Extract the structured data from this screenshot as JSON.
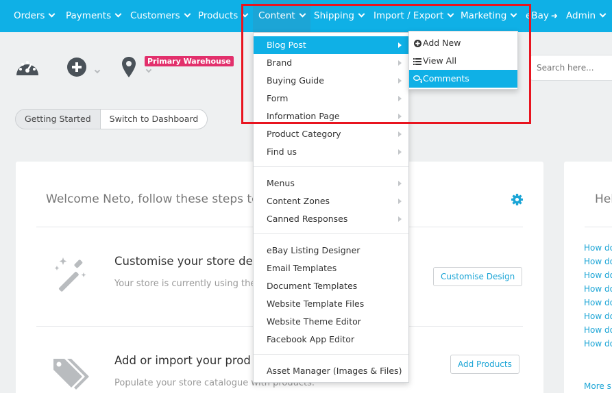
{
  "nav": {
    "items": [
      {
        "label": "Orders"
      },
      {
        "label": "Payments"
      },
      {
        "label": "Customers"
      },
      {
        "label": "Products"
      },
      {
        "label": "Content"
      },
      {
        "label": "Shipping"
      },
      {
        "label": "Import / Export"
      },
      {
        "label": "Marketing"
      },
      {
        "label": "eBay"
      },
      {
        "label": "Admin"
      }
    ]
  },
  "toolbar": {
    "warehouse_badge": "Primary Warehouse",
    "search_placeholder": "Search here..."
  },
  "view_toggle": {
    "getting_started": "Getting Started",
    "switch_dashboard": "Switch to Dashboard"
  },
  "welcome": {
    "title": "Welcome Neto, follow these steps to",
    "steps": [
      {
        "title": "Customise your store de",
        "subtitle": "Your store is currently using the",
        "button": "Customise Design"
      },
      {
        "title": "Add or import your prod",
        "subtitle": "Populate your store catalogue with products.",
        "button": "Add Products"
      }
    ]
  },
  "help": {
    "title": "Hel",
    "links": [
      "How do",
      "How do",
      "How do",
      "How do",
      "How do",
      "How do",
      "How do",
      "How do"
    ],
    "more": "More s"
  },
  "content_menu": {
    "groups": [
      [
        "Blog Post",
        "Brand",
        "Buying Guide",
        "Form",
        "Information Page",
        "Product Category",
        "Find us"
      ],
      [
        "Menus",
        "Content Zones",
        "Canned Responses"
      ],
      [
        "eBay Listing Designer",
        "Email Templates",
        "Document Templates",
        "Website Template Files",
        "Website Theme Editor",
        "Facebook App Editor"
      ],
      [
        "Asset Manager (Images & Files)"
      ]
    ]
  },
  "blog_submenu": {
    "items": [
      {
        "label": "Add New",
        "icon": "plus-circle-icon"
      },
      {
        "label": "View All",
        "icon": "list-icon"
      },
      {
        "label": "Comments",
        "icon": "comments-icon"
      }
    ]
  },
  "colors": {
    "accent": "#0fb0e6",
    "badge": "#e2306c",
    "highlight": "#e8141f"
  }
}
